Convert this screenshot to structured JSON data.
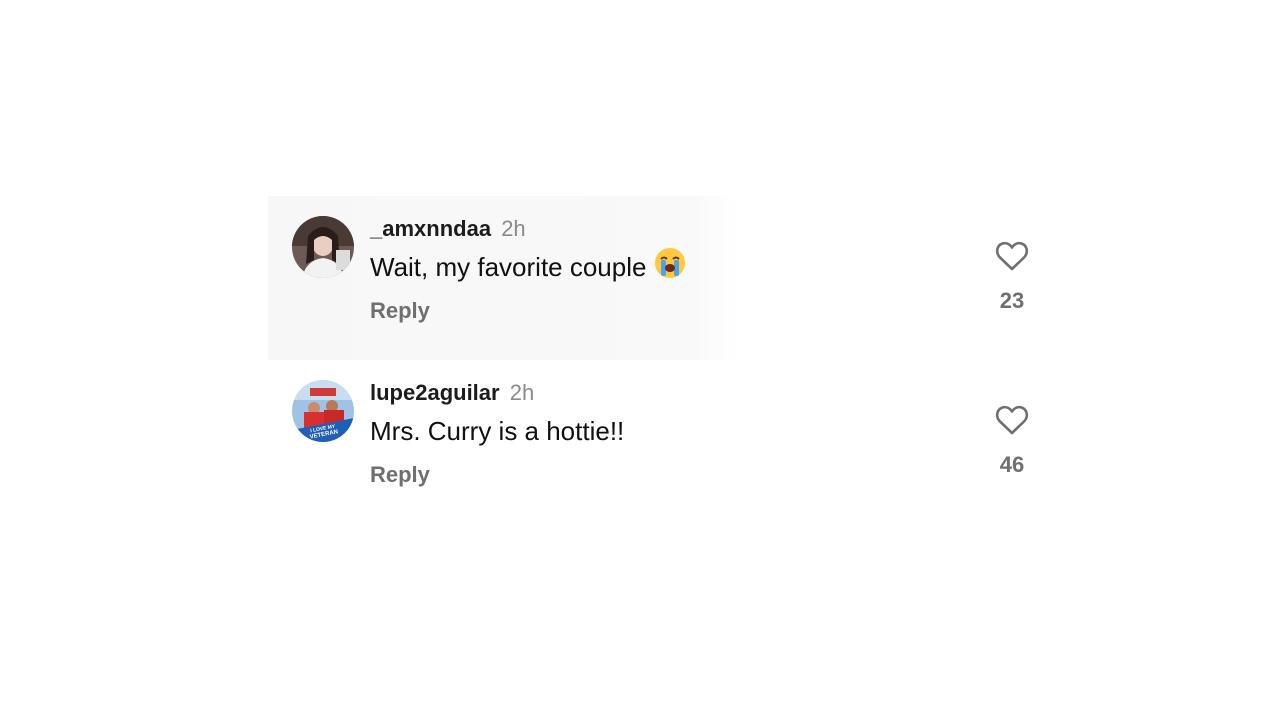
{
  "comments": [
    {
      "username": "_amxnndaa",
      "time": "2h",
      "text": "Wait, my favorite couple",
      "emoji": "loudly-crying-face-emoji",
      "reply_label": "Reply",
      "likes": "23",
      "avatar_icon": "profile-photo-woman"
    },
    {
      "username": "lupe2aguilar",
      "time": "2h",
      "text": "Mrs. Curry is a hottie!!",
      "reply_label": "Reply",
      "likes": "46",
      "avatar_icon": "profile-photo-veteran",
      "avatar_badge_text": "I LOVE MY VETERAN"
    }
  ],
  "colors": {
    "username": "#1c1c1c",
    "timestamp": "#8a8a8a",
    "secondary": "#6f6f6f",
    "heart_outline": "#6f6f6f",
    "highlight_bg": "#f7f7f7"
  }
}
